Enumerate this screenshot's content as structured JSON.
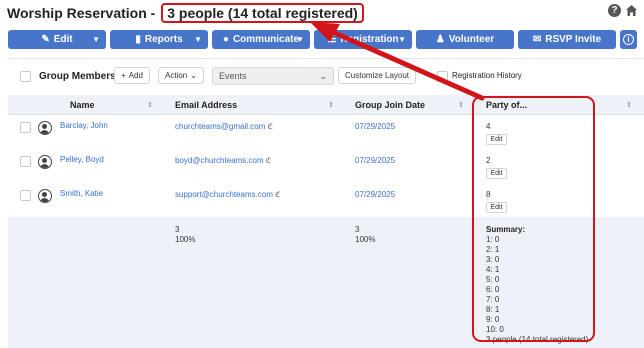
{
  "header": {
    "title": "Worship Reservation - ",
    "count": "3 people (14 total registered)"
  },
  "toolbar": {
    "edit": "Edit",
    "reports": "Reports",
    "communicate": "Communicate",
    "registration": "Registration",
    "volunteer": "Volunteer",
    "rsvp": "RSVP Invite"
  },
  "panel": {
    "group_members": "Group Members",
    "add": "Add",
    "action": "Action",
    "events": "Events",
    "customize": "Customize Layout",
    "reg_history": "Registration History"
  },
  "columns": {
    "name": "Name",
    "email": "Email Address",
    "join": "Group Join Date",
    "party": "Party of..."
  },
  "rows": [
    {
      "name": "Barclay, John",
      "email": "churchteams@gmail.com",
      "join": "07/29/2025",
      "party": "4",
      "edit": "Edit"
    },
    {
      "name": "Pelley, Boyd",
      "email": "boyd@churchteams.com",
      "join": "07/29/2025",
      "party": "2",
      "edit": "Edit"
    },
    {
      "name": "Smith, Katie",
      "email": "support@churchteams.com",
      "join": "07/29/2025",
      "party": "8",
      "edit": "Edit"
    }
  ],
  "summary": {
    "email_count": "3",
    "email_pct": "100%",
    "join_count": "3",
    "join_pct": "100%",
    "title": "Summary:",
    "lines": [
      "1: 0",
      "2: 1",
      "3: 0",
      "4: 1",
      "5: 0",
      "6: 0",
      "7: 0",
      "8: 1",
      "9: 0",
      "10: 0",
      "3 people (14 total registered)"
    ]
  },
  "colors": {
    "accent": "#4775c9",
    "link": "#3a6fd0",
    "highlight": "#d0161b",
    "table_header_bg": "#eef2f8"
  }
}
